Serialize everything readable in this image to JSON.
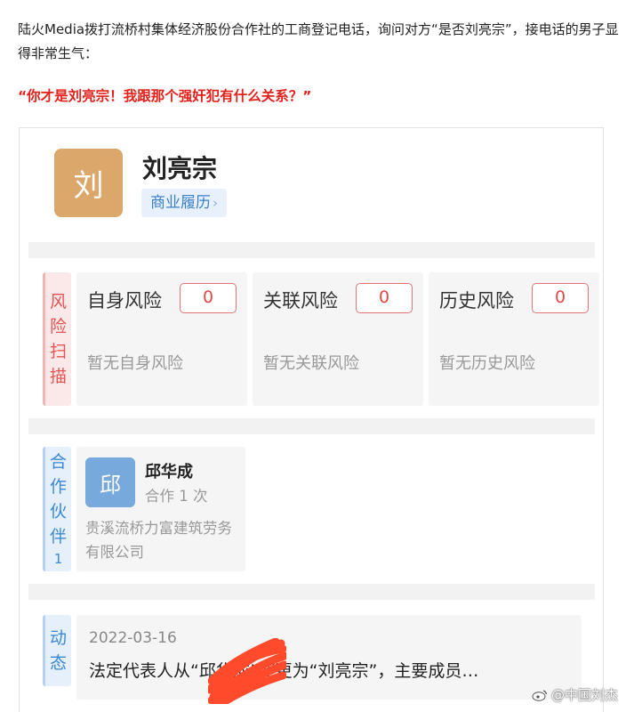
{
  "article": {
    "intro": "陆火Media拨打流桥村集体经济股份合作社的工商登记电话，询问对方“是否刘亮宗”，接电话的男子显得非常生气：",
    "quote": "“你才是刘亮宗！我跟那个强奸犯有什么关系？”"
  },
  "profile": {
    "avatar_char": "刘",
    "name": "刘亮宗",
    "biz_link": "商业履历",
    "avatar_color": "#dba76b"
  },
  "risk_scan": {
    "label_chars": [
      "风",
      "险",
      "扫",
      "描"
    ],
    "items": [
      {
        "title": "自身风险",
        "count": "0",
        "desc": "暂无自身风险"
      },
      {
        "title": "关联风险",
        "count": "0",
        "desc": "暂无关联风险"
      },
      {
        "title": "历史风险",
        "count": "0",
        "desc": "暂无历史风险"
      }
    ]
  },
  "partners": {
    "label_chars": [
      "合",
      "作",
      "伙",
      "伴"
    ],
    "count": "1",
    "items": [
      {
        "avatar_char": "邱",
        "name": "邱华成",
        "coop_times": "合作 1 次",
        "company": "贵溪流桥力富建筑劳务有限公司"
      }
    ]
  },
  "dynamics": {
    "label_chars": [
      "动",
      "态"
    ],
    "date": "2022-03-16",
    "text": "法定代表人从“邱华成”变更为“刘亮宗”，主要成员…"
  },
  "watermark": {
    "icon": "weibo-icon",
    "text": "@中国刘杰"
  },
  "colors": {
    "accent_red": "#e4201a",
    "risk_red": "#e24848",
    "link_blue": "#3a7fc8"
  }
}
